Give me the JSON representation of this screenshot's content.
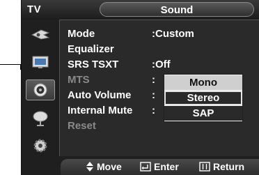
{
  "header": {
    "source": "TV",
    "title": "Sound"
  },
  "icons": [
    "picture-icon",
    "input-icon",
    "sound-icon",
    "channel-icon",
    "setup-icon"
  ],
  "menu": {
    "items": [
      {
        "label": "Mode",
        "value": ":Custom"
      },
      {
        "label": "Equalizer",
        "value": ""
      },
      {
        "label": "SRS TSXT",
        "value": ":Off"
      },
      {
        "label": "MTS",
        "value": ":"
      },
      {
        "label": "Auto Volume",
        "value": ":"
      },
      {
        "label": "Internal Mute",
        "value": ":"
      },
      {
        "label": "Reset",
        "value": ""
      }
    ]
  },
  "dropdown": {
    "options": [
      "Mono",
      "Stereo",
      "SAP"
    ],
    "highlighted": "Stereo"
  },
  "footer": {
    "move": "Move",
    "enter": "Enter",
    "return": "Return"
  },
  "colors": {
    "background": "#2a2a2a",
    "text": "#ffffff",
    "disabled": "#8a8a8a",
    "dropdown": "#f2f2f2"
  }
}
